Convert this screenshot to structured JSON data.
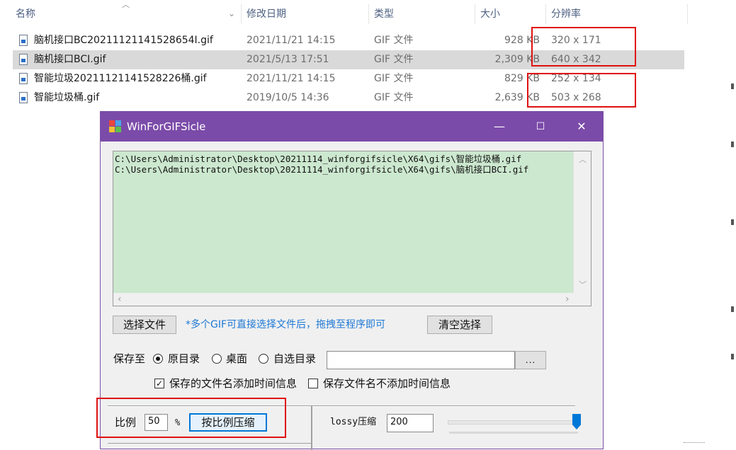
{
  "explorer": {
    "columns": {
      "name": "名称",
      "date": "修改日期",
      "type": "类型",
      "size": "大小",
      "resolution": "分辨率"
    },
    "files": [
      {
        "name": "脑机接口BC20211121141528654I.gif",
        "date": "2021/11/21 14:15",
        "type": "GIF 文件",
        "size": "928 KB",
        "resolution": "320 x 171",
        "selected": false
      },
      {
        "name": "脑机接口BCI.gif",
        "date": "2021/5/13 17:51",
        "type": "GIF 文件",
        "size": "2,309 KB",
        "resolution": "640 x 342",
        "selected": true
      },
      {
        "name": "智能垃圾20211121141528226桶.gif",
        "date": "2021/11/21 14:15",
        "type": "GIF 文件",
        "size": "829 KB",
        "resolution": "252 x 134",
        "selected": false
      },
      {
        "name": "智能垃圾桶.gif",
        "date": "2019/10/5 14:36",
        "type": "GIF 文件",
        "size": "2,639 KB",
        "resolution": "503 x 268",
        "selected": false
      }
    ]
  },
  "dialog": {
    "title": "WinForGIFSicle",
    "controls": {
      "minimize": "—",
      "maximize": "☐",
      "close": "✕"
    },
    "paths": [
      "C:\\Users\\Administrator\\Desktop\\20211114_winforgifsicle\\X64\\gifs\\智能垃圾桶.gif",
      "C:\\Users\\Administrator\\Desktop\\20211114_winforgifsicle\\X64\\gifs\\脑机接口BCI.gif"
    ],
    "select_file_btn": "选择文件",
    "hint": "*多个GIF可直接选择文件后，拖拽至程序即可",
    "clear_btn": "清空选择",
    "save_to_label": "保存至",
    "radio_options": [
      "原目录",
      "桌面",
      "自选目录"
    ],
    "radio_selected": 0,
    "custom_dir_value": "",
    "browse_btn": "...",
    "checkbox1_label": "保存的文件名添加时间信息",
    "checkbox1_checked": true,
    "checkbox2_label": "保存文件名不添加时间信息",
    "checkbox2_checked": false,
    "ratio_label": "比例",
    "ratio_value": "50",
    "percent_label": "%",
    "scale_btn": "按比例压缩",
    "lossy_label": "lossy压缩",
    "lossy_value": "200",
    "lossy_slider_level": 1.0
  },
  "colors": {
    "titlebar": "#7b4ba9",
    "list_bg": "#cce8cf",
    "highlight": "#e01010",
    "hint": "#1e78d6"
  }
}
